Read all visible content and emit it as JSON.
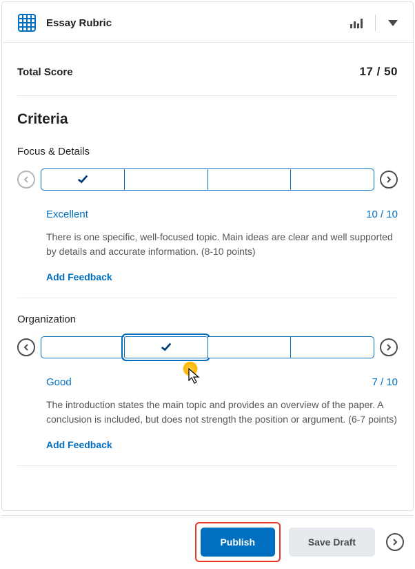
{
  "header": {
    "title": "Essay Rubric"
  },
  "score": {
    "label": "Total Score",
    "value": "17 / 50"
  },
  "criteria_heading": "Criteria",
  "criteria": [
    {
      "title": "Focus & Details",
      "selected_index": 0,
      "level_label": "Excellent",
      "level_score": "10 / 10",
      "description": "There is one specific, well-focused topic. Main ideas are clear and well supported by details and accurate information. (8-10 points)",
      "add_feedback_label": "Add Feedback"
    },
    {
      "title": "Organization",
      "selected_index": 1,
      "level_label": "Good",
      "level_score": "7 / 10",
      "description": "The introduction states the main topic and provides an overview of the paper. A conclusion is included, but does not strength the position or argument. (6-7 points)",
      "add_feedback_label": "Add Feedback"
    }
  ],
  "footer": {
    "publish_label": "Publish",
    "save_draft_label": "Save Draft"
  }
}
